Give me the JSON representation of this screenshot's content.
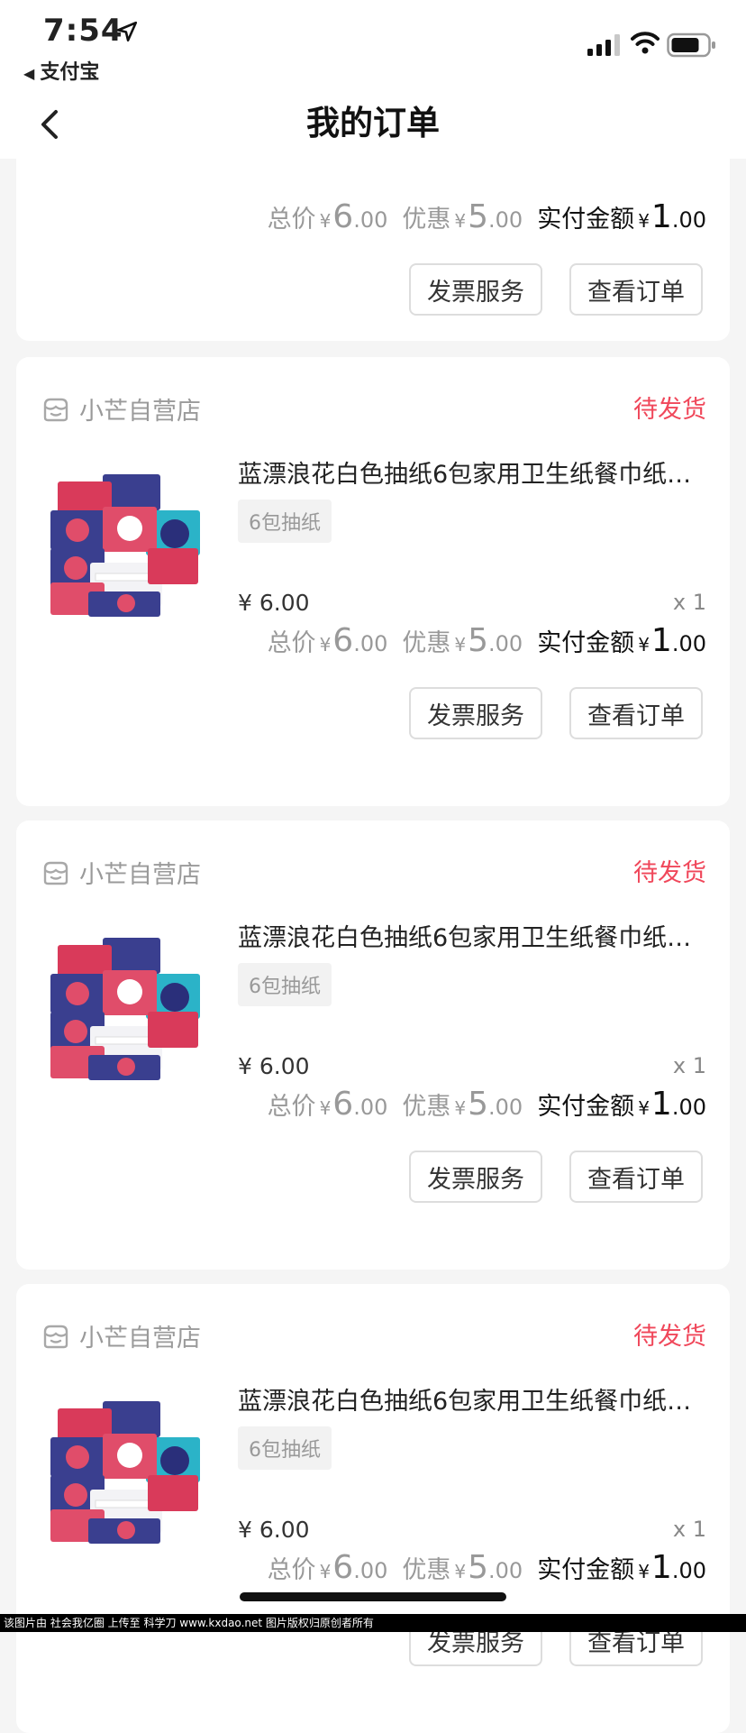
{
  "status_bar": {
    "time": "7:54",
    "back_app": "支付宝"
  },
  "nav": {
    "title": "我的订单"
  },
  "labels": {
    "total": "总价",
    "discount": "优惠",
    "paid": "实付金额",
    "yen": "¥",
    "invoice_button": "发票服务",
    "view_order_button": "查看订单"
  },
  "top_summary": {
    "total_int": "6",
    "total_dec": ".00",
    "discount_int": "5",
    "discount_dec": ".00",
    "paid_int": "1",
    "paid_dec": ".00"
  },
  "orders": [
    {
      "shop": "小芒自营店",
      "status": "待发货",
      "title": "蓝漂浪花白色抽纸6包家用卫生纸餐巾纸…",
      "spec": "6包抽纸",
      "price": "¥ 6.00",
      "qty": "x 1",
      "total_int": "6",
      "total_dec": ".00",
      "discount_int": "5",
      "discount_dec": ".00",
      "paid_int": "1",
      "paid_dec": ".00"
    },
    {
      "shop": "小芒自营店",
      "status": "待发货",
      "title": "蓝漂浪花白色抽纸6包家用卫生纸餐巾纸…",
      "spec": "6包抽纸",
      "price": "¥ 6.00",
      "qty": "x 1",
      "total_int": "6",
      "total_dec": ".00",
      "discount_int": "5",
      "discount_dec": ".00",
      "paid_int": "1",
      "paid_dec": ".00"
    },
    {
      "shop": "小芒自营店",
      "status": "待发货",
      "title": "蓝漂浪花白色抽纸6包家用卫生纸餐巾纸…",
      "spec": "6包抽纸",
      "price": "¥ 6.00",
      "qty": "x 1",
      "total_int": "6",
      "total_dec": ".00",
      "discount_int": "5",
      "discount_dec": ".00",
      "paid_int": "1",
      "paid_dec": ".00"
    }
  ],
  "watermark": "该图片由 社会我亿圈 上传至 科学刀 www.kxdao.net 图片版权归原创者所有",
  "colors": {
    "status_red": "#f0475a",
    "background": "#f5f5f5"
  }
}
